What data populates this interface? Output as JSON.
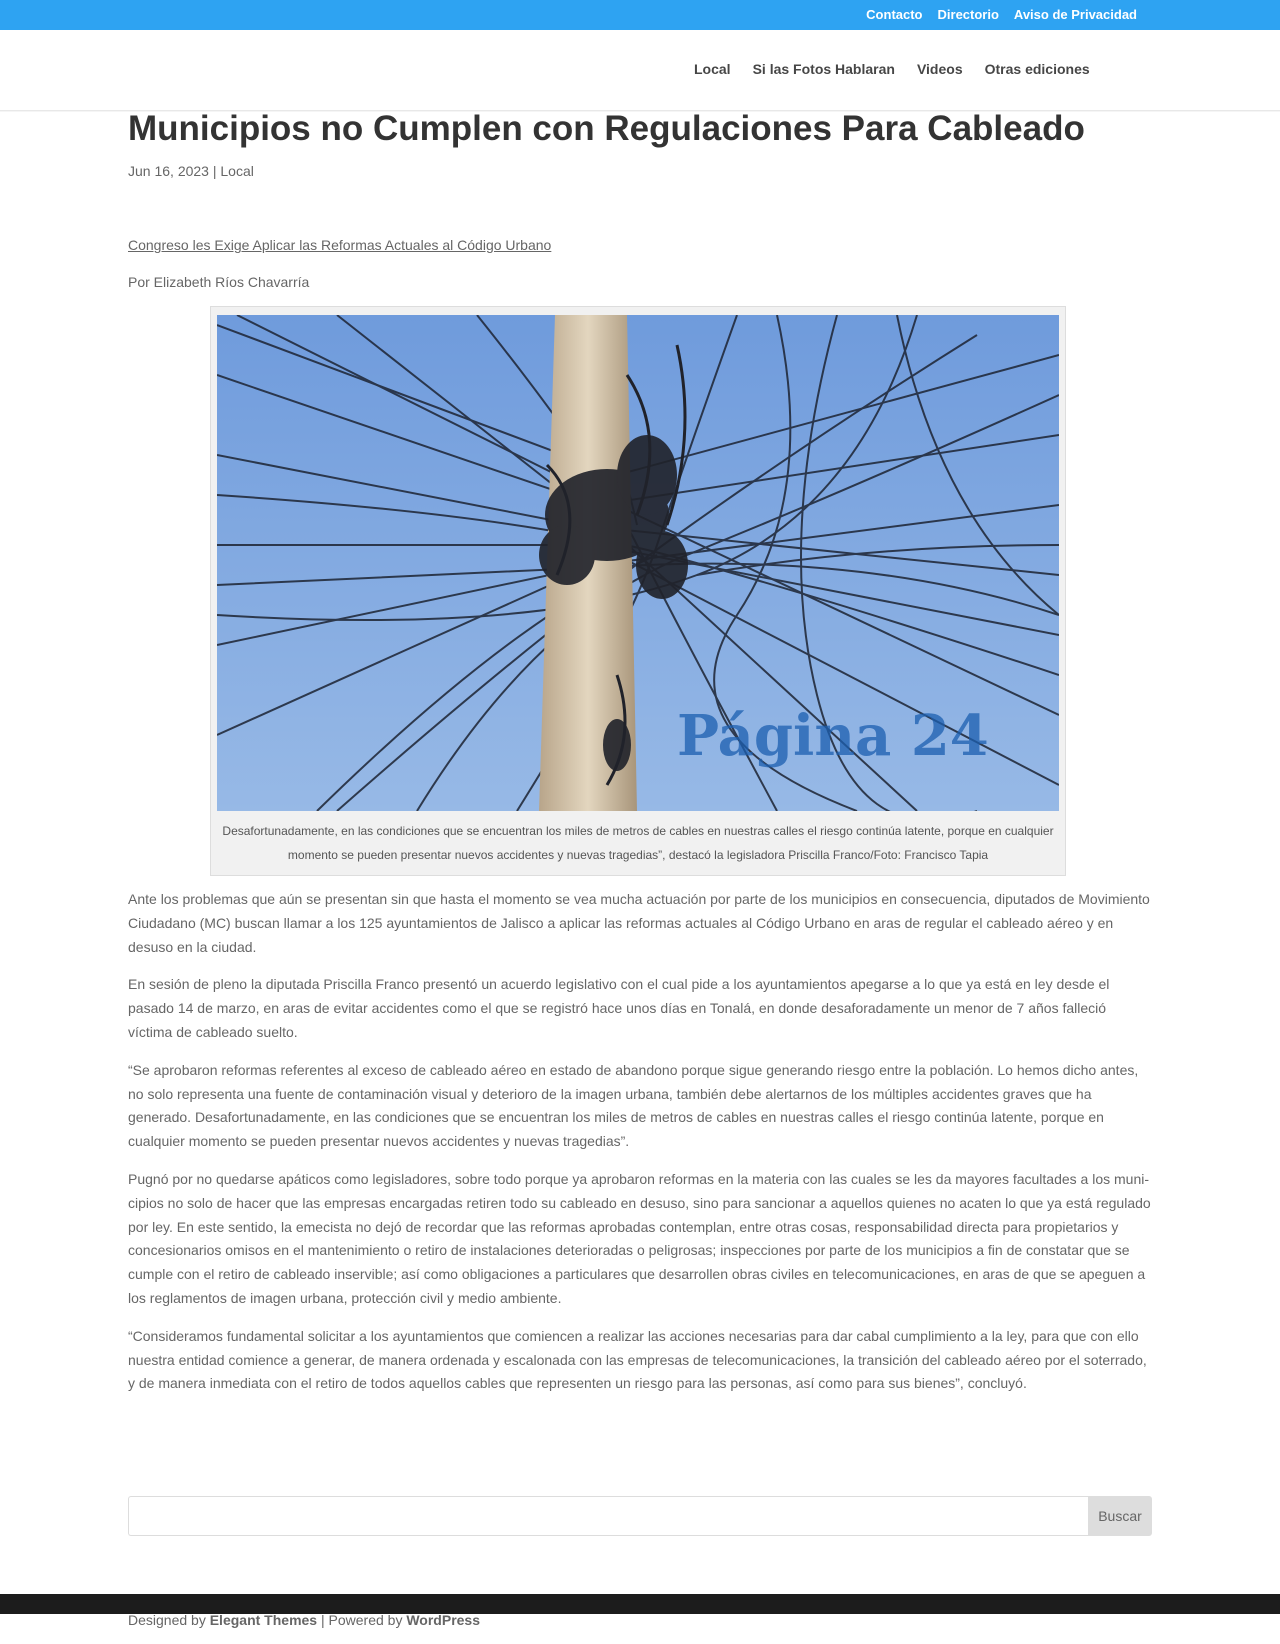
{
  "top_bar": {
    "links": [
      "Contacto",
      "Directorio",
      "Aviso de Privacidad"
    ]
  },
  "nav": {
    "items": [
      "Local",
      "Si las Fotos Hablaran",
      "Videos",
      "Otras ediciones"
    ]
  },
  "article": {
    "title": "Municipios no Cumplen con Regulaciones Para Cableado",
    "date": "Jun 16, 2023",
    "separator": "|",
    "category": "Local",
    "subtitle": "Congreso les Exige Aplicar las Reformas Actuales al Código Urbano",
    "byline": "Por Elizabeth Ríos Chavarría",
    "image": {
      "watermark": "Página 24",
      "caption": "Desafortunadamente, en las condiciones que se encuentran los miles de metros de cables en nuestras calles el riesgo continúa latente, porque en cualquier momento se pueden presentar nuevos accidentes y nuevas tragedias”, destacó la legisladora Priscilla Franco/Foto: Francisco Tapia"
    },
    "paragraphs": [
      "Ante los problemas que aún se presentan sin que hasta el momento se vea mucha actuación por parte de los municipios en consecuencia, diputados de Movimiento Ciudadano (MC) buscan llamar a los 125 ayuntamientos de Jalisco a aplicar las reformas actuales al Código Urbano en aras de regular el cableado aéreo y en desuso en la ciudad.",
      "En sesión de pleno la diputada Priscilla Franco presentó un acuerdo legislativo con el cual pide a los ayuntamientos apegarse a lo que ya está en ley desde el pasado 14 de marzo, en aras de evitar accidentes como el que se registró hace unos días en Tonalá, en donde desaforadamente un menor de 7 años falleció víctima de cableado suelto.",
      "“Se aprobaron reformas referentes al exceso de cableado aéreo en estado de abandono porque sigue generando riesgo entre la población. Lo hemos dicho antes, no solo representa una fuente de contaminación visual y deterioro de la imagen urbana, también debe alertarnos de los múltiples accidentes graves que ha generado. Desafortunadamente, en las condiciones que se encuentran los miles de metros de cables en nuestras calles el riesgo continúa latente, porque en cualquier momento se pueden presentar nuevos accidentes y nuevas tragedias”.",
      "Pugnó por no quedarse apáticos como legisladores, sobre todo porque ya aprobaron reformas en la materia con las cuales se les da mayores facultades a los muni­cipios no solo de hacer que las empresas encargadas retiren todo su cableado en desuso, sino para sancionar a aquellos quienes no acaten lo que ya está regulado por ley. En este sentido, la emecista no dejó de recordar que las reformas aprobadas contemplan, entre otras cosas, responsabilidad directa para propietarios y concesionarios omisos en el mantenimiento o retiro de instalaciones deterioradas o peligrosas; inspecciones por parte de los municipios a fin de constatar que se cumple con el retiro de cableado inservible; así como obligaciones a particulares que desarrollen obras civiles en telecomunicaciones, en aras de que se apeguen a los reglamentos de imagen urbana, protección civil y medio ambiente.",
      "“Consideramos fundamental solicitar a los ayuntamientos que comiencen a realizar las acciones necesarias para dar cabal cumplimiento a la ley, para que con ello nuestra entidad comience a generar, de manera ordenada y escalonada con las empresas de telecomunicaciones, la transición del cableado aéreo por el soterrado, y de manera inmediata con el retiro de todos aquellos cables que representen un riesgo para las personas, así como para sus bienes”, concluyó."
    ]
  },
  "search": {
    "placeholder": "",
    "button_label": "Buscar"
  },
  "footer": {
    "designed_by": "Designed by",
    "designer": "Elegant Themes",
    "powered_sep": "| Powered by",
    "platform": "WordPress"
  },
  "colors": {
    "accent": "#2ea3f2",
    "footer_bar": "#1c1c1c"
  }
}
